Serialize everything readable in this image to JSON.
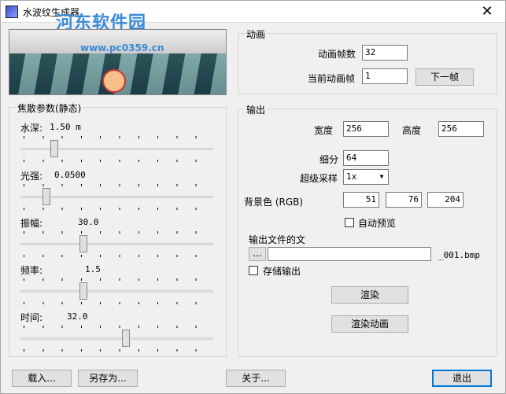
{
  "window": {
    "title": "水波纹生成器",
    "watermark": "河东软件园",
    "close_glyph": "✕"
  },
  "preview": {
    "url": "www.pc0359.cn"
  },
  "animation": {
    "group_label": "动画",
    "frames_label": "动画帧数",
    "frames_value": "32",
    "current_label": "当前动画帧",
    "current_value": "1",
    "next_button": "下一帧"
  },
  "focus": {
    "group_label": "焦散参数(静态)",
    "sliders": [
      {
        "label": "水深:",
        "value": "1.50 m",
        "position": 0.16
      },
      {
        "label": "光强:",
        "value": "0.0500",
        "position": 0.12
      },
      {
        "label": "振幅:",
        "value": "30.0",
        "position": 0.32
      },
      {
        "label": "频率:",
        "value": "1.5",
        "position": 0.32
      },
      {
        "label": "时间:",
        "value": "32.0",
        "position": 0.55
      }
    ]
  },
  "output": {
    "group_label": "输出",
    "width_label": "宽度",
    "width_value": "256",
    "height_label": "高度",
    "height_value": "256",
    "subdiv_label": "细分",
    "subdiv_value": "64",
    "supersample_label": "超级采样",
    "supersample_value": "1x",
    "bg_label": "背景色 (RGB)",
    "bg_r": "51",
    "bg_g": "76",
    "bg_b": "204",
    "autopreview_label": "自动预览",
    "autopreview_checked": false,
    "file_label": "输出文件的文",
    "browse_button": "...",
    "file_value": "",
    "file_suffix": "_001.bmp",
    "save_output_label": "存储输出",
    "save_output_checked": false,
    "render_button": "渲染",
    "render_anim_button": "渲染动画"
  },
  "footer": {
    "load_button": "载入...",
    "saveas_button": "另存为...",
    "about_button": "关于...",
    "exit_button": "退出"
  }
}
